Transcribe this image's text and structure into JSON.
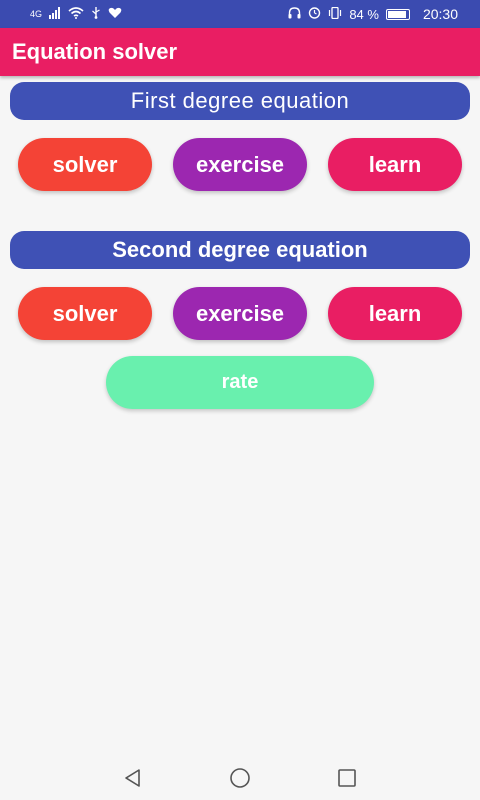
{
  "status_bar": {
    "network": "4G",
    "battery": "84 %",
    "time": "20:30",
    "icons": [
      "signal-icon",
      "wifi-icon",
      "usb-icon",
      "heart-icon",
      "headphones-icon",
      "alarm-icon",
      "vibrate-icon",
      "battery-icon"
    ]
  },
  "app_bar": {
    "title": "Equation solver"
  },
  "first_degree": {
    "title": "First degree equation",
    "solver_label": "solver",
    "exercise_label": "exercise",
    "learn_label": "learn"
  },
  "second_degree": {
    "title": "Second degree equation",
    "solver_label": "solver",
    "exercise_label": "exercise",
    "learn_label": "learn"
  },
  "rate_label": "rate",
  "colors": {
    "app_bar": "#e91e63",
    "header_pill": "#3f51b5",
    "solver": "#f44336",
    "exercise": "#9c27b0",
    "learn": "#e91e63",
    "rate": "#69f0ae"
  },
  "nav_bar": {
    "icons": [
      "back-icon",
      "home-icon",
      "recents-icon"
    ]
  }
}
